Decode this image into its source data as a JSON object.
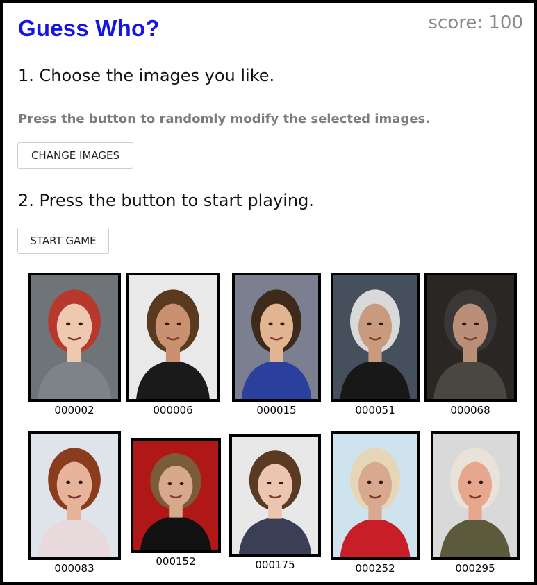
{
  "app": {
    "title": "Guess Who?",
    "score_label": "score: 100"
  },
  "step1": {
    "heading": "1. Choose the images you like.",
    "hint": "Press the button to randomly modify the selected images.",
    "button": "CHANGE IMAGES"
  },
  "step2": {
    "heading": "2. Press the button to start playing.",
    "button": "START GAME"
  },
  "images": [
    {
      "id": "000002",
      "bg": "#6f7478",
      "hair": "#b7392e",
      "skin": "#efc8b0",
      "cloth": "#7d8388"
    },
    {
      "id": "000006",
      "bg": "#e9e9e9",
      "hair": "#5a3a1e",
      "skin": "#c99170",
      "cloth": "#1a1a1a"
    },
    {
      "id": "000015",
      "bg": "#7b7f90",
      "hair": "#3d2a1b",
      "skin": "#e2b592",
      "cloth": "#2b3f9c"
    },
    {
      "id": "000051",
      "bg": "#46505c",
      "hair": "#d9d9d9",
      "skin": "#c89b7e",
      "cloth": "#181818"
    },
    {
      "id": "000068",
      "bg": "#2a2624",
      "hair": "#3a3836",
      "skin": "#b99077",
      "cloth": "#4a4640"
    },
    {
      "id": "000083",
      "bg": "#dfe3ea",
      "hair": "#8a3c1e",
      "skin": "#e7b49b",
      "cloth": "#e8d9dc"
    },
    {
      "id": "000152",
      "bg": "#b01818",
      "hair": "#7a5c3b",
      "skin": "#d8a88c",
      "cloth": "#111111"
    },
    {
      "id": "000175",
      "bg": "#e8e8e8",
      "hair": "#5a3a22",
      "skin": "#ecc5b0",
      "cloth": "#3a3f55"
    },
    {
      "id": "000252",
      "bg": "#cfe3ef",
      "hair": "#e6d6b8",
      "skin": "#d9a98f",
      "cloth": "#c81e28"
    },
    {
      "id": "000295",
      "bg": "#d9d9d9",
      "hair": "#e9e2d9",
      "skin": "#e7a78f",
      "cloth": "#5b5a3d"
    }
  ]
}
